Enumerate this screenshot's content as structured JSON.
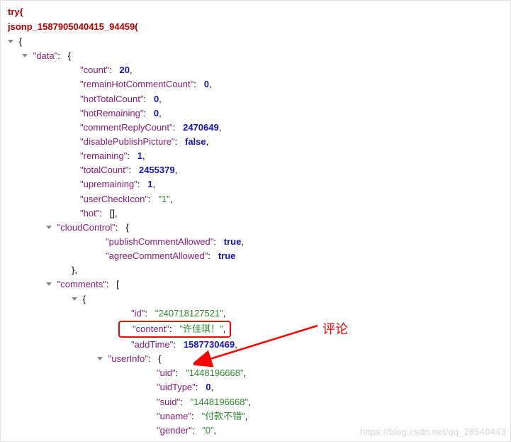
{
  "try_line": "try{",
  "jsonp_call": "jsonp_1587905040415_94459(",
  "root_open": "{",
  "data_key": "data",
  "fields": {
    "count": {
      "k": "count",
      "v": "20"
    },
    "remainHotCommentCount": {
      "k": "remainHotCommentCount",
      "v": "0"
    },
    "hotTotalCount": {
      "k": "hotTotalCount",
      "v": "0"
    },
    "hotRemaining": {
      "k": "hotRemaining",
      "v": "0"
    },
    "commentReplyCount": {
      "k": "commentReplyCount",
      "v": "2470649"
    },
    "disablePublishPicture": {
      "k": "disablePublishPicture",
      "v": "false"
    },
    "remaining": {
      "k": "remaining",
      "v": "1"
    },
    "totalCount": {
      "k": "totalCount",
      "v": "2455379"
    },
    "upremaining": {
      "k": "upremaining",
      "v": "1"
    },
    "userCheckIcon": {
      "k": "userCheckIcon",
      "v": "1"
    },
    "hot": {
      "k": "hot",
      "v": "[]"
    }
  },
  "cloudControl": {
    "key": "cloudControl",
    "publishCommentAllowed": {
      "k": "publishCommentAllowed",
      "v": "true"
    },
    "agreeCommentAllowed": {
      "k": "agreeCommentAllowed",
      "v": "true"
    }
  },
  "comments": {
    "key": "comments",
    "item": {
      "id": {
        "k": "id",
        "v": "240718127521"
      },
      "content": {
        "k": "content",
        "v": "许佳琪！"
      },
      "addTime": {
        "k": "addTime",
        "v": "1587730469"
      },
      "userInfo": {
        "key": "userInfo",
        "uid": {
          "k": "uid",
          "v": "1448196668"
        },
        "uidType": {
          "k": "uidType",
          "v": "0"
        },
        "suid": {
          "k": "suid",
          "v": "1448196668"
        },
        "uname": {
          "k": "uname",
          "v": "付款不错"
        },
        "gender": {
          "k": "gender",
          "v": "0"
        }
      }
    }
  },
  "annotation_label": "评论",
  "watermark": "https://blog.csdn.net/qq_28540443"
}
